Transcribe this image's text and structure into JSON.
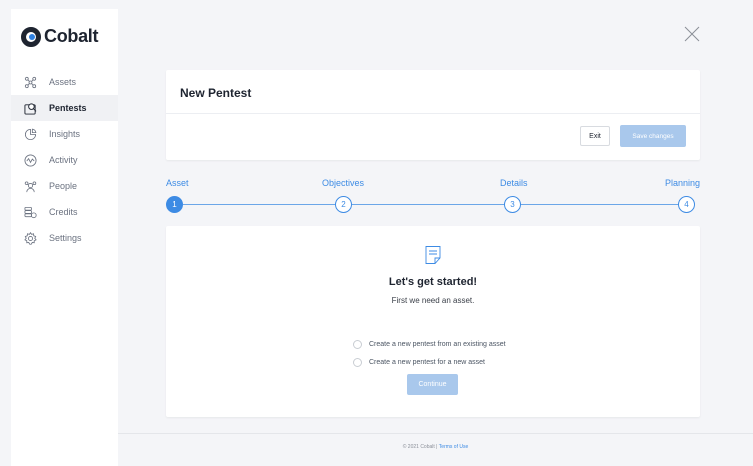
{
  "app": {
    "name": "Cobalt"
  },
  "sidebar": {
    "items": [
      {
        "label": "Assets",
        "icon": "assets-icon",
        "active": false
      },
      {
        "label": "Pentests",
        "icon": "pentests-icon",
        "active": true
      },
      {
        "label": "Insights",
        "icon": "insights-icon",
        "active": false
      },
      {
        "label": "Activity",
        "icon": "activity-icon",
        "active": false
      },
      {
        "label": "People",
        "icon": "people-icon",
        "active": false
      },
      {
        "label": "Credits",
        "icon": "credits-icon",
        "active": false
      },
      {
        "label": "Settings",
        "icon": "settings-icon",
        "active": false
      }
    ]
  },
  "header": {
    "title": "New Pentest",
    "exit_label": "Exit",
    "save_label": "Save changes"
  },
  "stepper": {
    "steps": [
      {
        "label": "Asset",
        "number": "1",
        "active": true
      },
      {
        "label": "Objectives",
        "number": "2",
        "active": false
      },
      {
        "label": "Details",
        "number": "3",
        "active": false
      },
      {
        "label": "Planning",
        "number": "4",
        "active": false
      }
    ]
  },
  "content": {
    "title": "Let's get started!",
    "subtitle": "First we need an asset.",
    "options": [
      {
        "label": "Create a new pentest from an existing asset",
        "selected": false
      },
      {
        "label": "Create a new pentest for a new asset",
        "selected": false
      }
    ],
    "continue_label": "Continue"
  },
  "footer": {
    "copyright": "© 2021 Cobalt",
    "separator": "|",
    "terms_label": "Terms of Use"
  },
  "colors": {
    "accent": "#3d8be4",
    "button_disabled": "#a9c8ec",
    "background": "#f4f5f8"
  }
}
